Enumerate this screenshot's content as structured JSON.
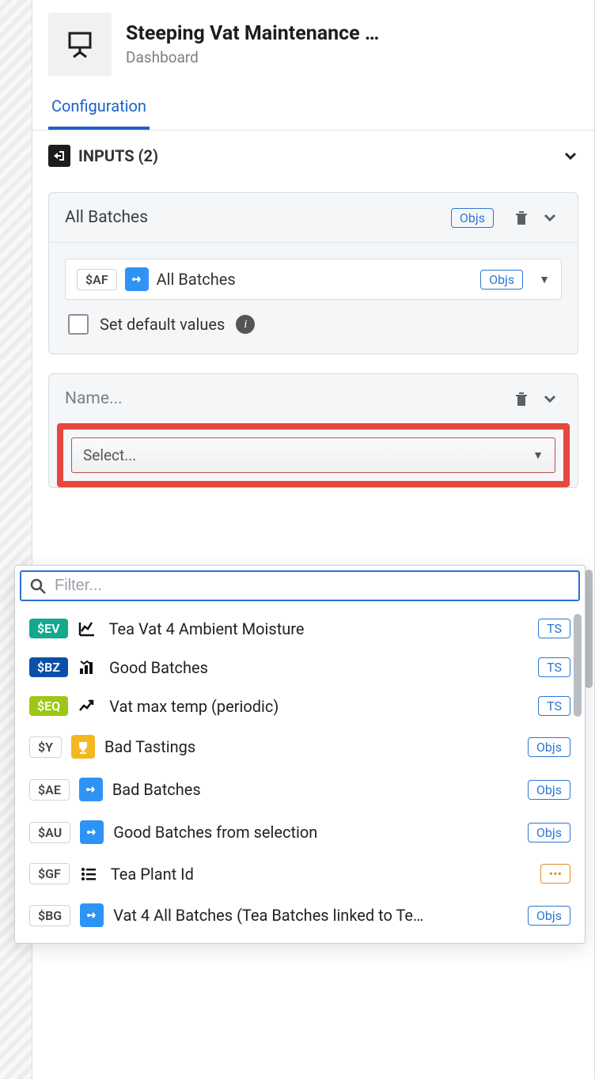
{
  "header": {
    "title": "Steeping Vat Maintenance …",
    "subtitle": "Dashboard"
  },
  "tab": {
    "configuration": "Configuration"
  },
  "inputsSection": {
    "title": "INPUTS (2)"
  },
  "card1": {
    "name": "All Batches",
    "badge": "Objs",
    "link": {
      "var": "$AF",
      "label": "All Batches",
      "badge": "Objs"
    },
    "defaults_label": "Set default values"
  },
  "card2": {
    "name_placeholder": "Name...",
    "select_placeholder": "Select..."
  },
  "filter": {
    "placeholder": "Filter..."
  },
  "options": {
    "0": {
      "var": "$EV",
      "label": "Tea Vat 4 Ambient Moisture",
      "badge": "TS"
    },
    "1": {
      "var": "$BZ",
      "label": "Good Batches",
      "badge": "TS"
    },
    "2": {
      "var": "$EQ",
      "label": "Vat max temp (periodic)",
      "badge": "TS"
    },
    "3": {
      "var": "$Y",
      "label": "Bad Tastings",
      "badge": "Objs"
    },
    "4": {
      "var": "$AE",
      "label": "Bad Batches",
      "badge": "Objs"
    },
    "5": {
      "var": "$AU",
      "label": "Good Batches from selection",
      "badge": "Objs"
    },
    "6": {
      "var": "$GF",
      "label": "Tea Plant Id",
      "badge": "•••"
    },
    "7": {
      "var": "$BG",
      "label": "Vat 4 All Batches (Tea Batches linked to Te…",
      "badge": "Objs"
    }
  }
}
